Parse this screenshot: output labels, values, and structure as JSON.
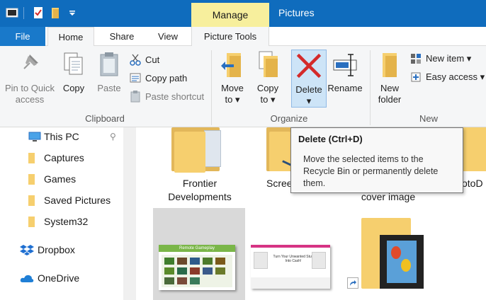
{
  "title_bar": {
    "contextual_tab": "Manage",
    "window_title": "Pictures"
  },
  "tabs": {
    "file": "File",
    "home": "Home",
    "share": "Share",
    "view": "View",
    "picture_tools": "Picture Tools"
  },
  "ribbon": {
    "clipboard": {
      "pin_line1": "Pin to Quick",
      "pin_line2": "access",
      "copy": "Copy",
      "paste": "Paste",
      "cut": "Cut",
      "copy_path": "Copy path",
      "paste_shortcut": "Paste shortcut",
      "group_label": "Clipboard"
    },
    "organize": {
      "move_line1": "Move",
      "move_line2": "to",
      "copy_line1": "Copy",
      "copy_line2": "to",
      "delete_line1": "Delete",
      "rename": "Rename",
      "group_label": "Organize"
    },
    "new": {
      "new_folder_line1": "New",
      "new_folder_line2": "folder",
      "new_item": "New item",
      "easy_access": "Easy access",
      "group_label": "New"
    }
  },
  "nav_pane": {
    "items": [
      {
        "label": "This PC",
        "icon": "computer-icon"
      },
      {
        "label": "Captures",
        "icon": "folder-icon"
      },
      {
        "label": "Games",
        "icon": "folder-icon"
      },
      {
        "label": "Saved Pictures",
        "icon": "folder-icon"
      },
      {
        "label": "System32",
        "icon": "folder-icon"
      },
      {
        "label": "Dropbox",
        "icon": "dropbox-icon"
      },
      {
        "label": "OneDrive",
        "icon": "onedrive-icon"
      }
    ]
  },
  "content": {
    "items": [
      {
        "line1": "Frontier",
        "line2": "Developments"
      },
      {
        "line1": "Scree"
      },
      {
        "line1": "otoD",
        "line2": "cover image"
      }
    ],
    "thumb_header": "Remote Gameplay",
    "thumb_ad": "Turn Your Unwanted Stuff Into Cash!"
  },
  "tooltip": {
    "title": "Delete (Ctrl+D)",
    "line1": "Move the selected items to the",
    "line2": "Recycle Bin or permanently delete",
    "line3": "them."
  },
  "colors": {
    "titlebar": "#0f6cbd",
    "manage_tab": "#f7ef9d",
    "file_tab": "#1979ca",
    "delete_red": "#d42a2a",
    "folder_yellow": "#f6cf6e"
  }
}
